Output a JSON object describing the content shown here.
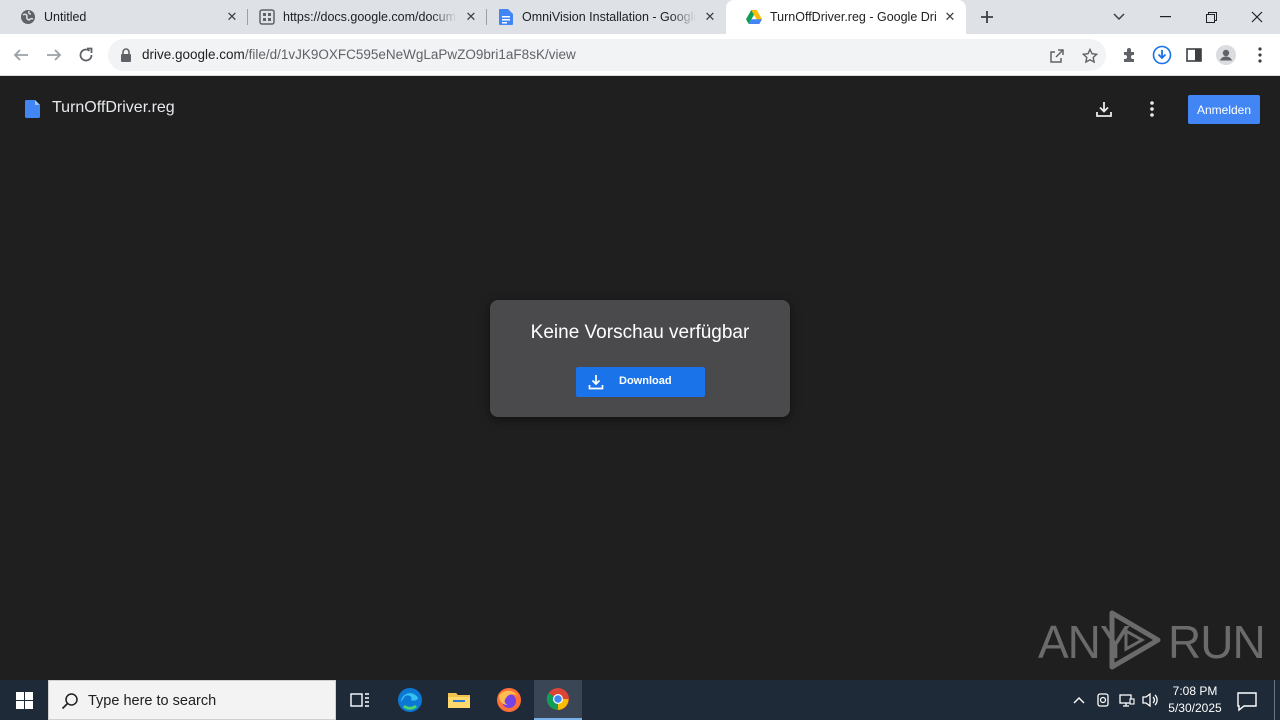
{
  "tabs": [
    {
      "title": "Untitled",
      "icon": "globe-icon"
    },
    {
      "title": "https://docs.google.com/document/",
      "icon": "docs-grid-icon"
    },
    {
      "title": "OmniVision Installation - Google Docs",
      "icon": "google-docs-icon"
    },
    {
      "title": "TurnOffDriver.reg - Google Drive",
      "icon": "google-drive-icon"
    }
  ],
  "omnibox": {
    "host": "drive.google.com",
    "path": "/file/d/1vJK9OXFC595eNeWgLaPwZO9bri1aF8sK/view"
  },
  "viewer": {
    "file_name": "TurnOffDriver.reg",
    "signin_label": "Anmelden",
    "no_preview_message": "Keine Vorschau verfügbar",
    "download_label": "Download"
  },
  "watermark": {
    "left": "ANY",
    "right": "RUN"
  },
  "taskbar": {
    "search_placeholder": "Type here to search",
    "time": "7:08 PM",
    "date": "5/30/2025",
    "apps": [
      "task-view",
      "edge",
      "file-explorer",
      "firefox",
      "chrome"
    ]
  },
  "colors": {
    "accent": "#1a73e8",
    "signin": "#4285f4",
    "viewer_bg": "#1f1f1f",
    "dialog_bg": "#4a4a4d",
    "taskbar_bg": "#1f2a38"
  }
}
